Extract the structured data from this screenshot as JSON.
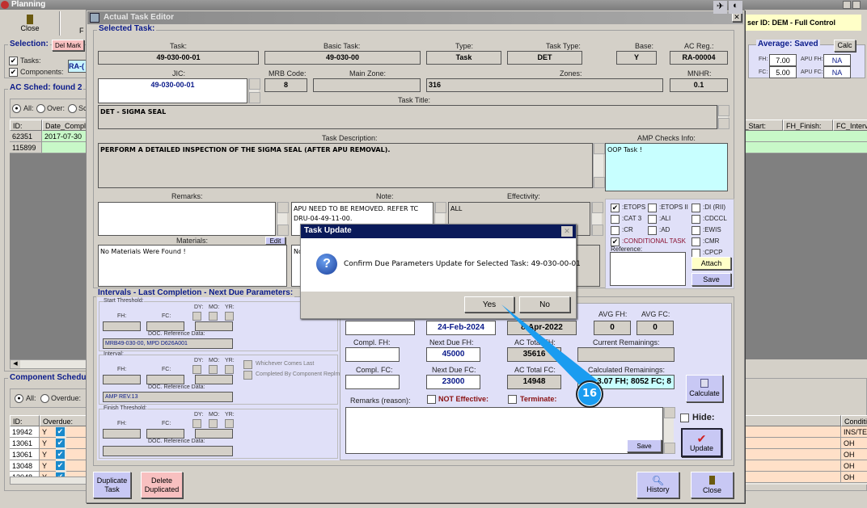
{
  "app": {
    "title": "Planning",
    "toolbar": {
      "close_label": "Close",
      "f_label": "F"
    },
    "user_id": "ser ID: DEM - Full Control",
    "selection": {
      "title": "Selection:",
      "del_mark": "Del Mark",
      "tasks": "Tasks:",
      "components": "Components:",
      "reg_partial": "RA-("
    },
    "average": {
      "title": "Average: Saved",
      "calc": "Calc",
      "fh_label": "FH:",
      "fh": "7.00",
      "fc_label": "FC:",
      "fc": "5.00",
      "apu_fh_label": "APU FH:",
      "apu_fh": "NA",
      "apu_fc_label": "APU FC:",
      "apu_fc": "NA"
    },
    "ac_sched": {
      "title": "AC Sched:  found  2",
      "radios": [
        "All:",
        "Over:",
        "Sc"
      ],
      "columns": [
        "ID:",
        "Date_Compl",
        "H_Start:",
        "FH_Finish:",
        "FC_Interv"
      ],
      "rows": [
        {
          "id": "62351",
          "date": "2017-07-30"
        },
        {
          "id": "115899",
          "date": ""
        }
      ]
    },
    "component_schedule": {
      "title": "Component Schedul",
      "radios": [
        "All:",
        "Overdue:"
      ],
      "columns": [
        "ID:",
        "Overdue:",
        "Conditio"
      ],
      "rows": [
        {
          "id": "19942",
          "overdue": "Y",
          "condition": "INS/TES"
        },
        {
          "id": "13061",
          "overdue": "Y",
          "condition": "OH"
        },
        {
          "id": "13061",
          "overdue": "Y",
          "condition": "OH"
        },
        {
          "id": "13048",
          "overdue": "Y",
          "condition": "OH"
        },
        {
          "id": "13048",
          "overdue": "Y",
          "condition": "OH"
        }
      ]
    }
  },
  "editor": {
    "title": "Actual Task Editor",
    "selected_task": {
      "title": "Selected Task:",
      "task_label": "Task:",
      "task": "49-030-00-01",
      "basic_task_label": "Basic Task:",
      "basic_task": "49-030-00",
      "type_label": "Type:",
      "type": "Task",
      "task_type_label": "Task Type:",
      "task_type": "DET",
      "base_label": "Base:",
      "base": "Y",
      "ac_reg_label": "AC Reg.:",
      "ac_reg": "RA-00004",
      "jic_label": "JIC:",
      "jic": "49-030-00-01",
      "mrb_label": "MRB Code:",
      "mrb": "8",
      "main_zone_label": "Main Zone:",
      "main_zone": "",
      "zones_label": "Zones:",
      "zones": "316",
      "mnhr_label": "MNHR:",
      "mnhr": "0.1",
      "title_label": "Task Title:",
      "task_title": "DET - SIGMA SEAL",
      "desc_label": "Task Description:",
      "description": "PERFORM A DETAILED INSPECTION OF THE SIGMA SEAL (AFTER APU REMOVAL).",
      "amp_label": "AMP Checks Info:",
      "amp": "OOP Task !",
      "remarks_label": "Remarks:",
      "remarks": "",
      "note_label": "Note:",
      "note": "APU NEED TO BE REMOVED. REFER TC DRU-04-49-11-00.",
      "effectivity_label": "Effectivity:",
      "effectivity": "ALL",
      "materials_label": "Materials:",
      "materials_edit": "Edit",
      "materials": "No Materials Were Found !",
      "note2": "No"
    },
    "flags": {
      "items": [
        {
          "label": ":ETOPS",
          "checked": true
        },
        {
          "label": ":ETOPS II",
          "checked": false
        },
        {
          "label": ":DI (RII)",
          "checked": false
        },
        {
          "label": ":CAT 3",
          "checked": false
        },
        {
          "label": ":ALI",
          "checked": false
        },
        {
          "label": ":CDCCL",
          "checked": false
        },
        {
          "label": ":CR",
          "checked": false
        },
        {
          "label": ":AD",
          "checked": false
        },
        {
          "label": ":EWIS",
          "checked": false
        },
        {
          "label": ":CONDITIONAL TASK",
          "checked": true
        },
        {
          "label": ":CMR",
          "checked": false
        },
        {
          "label": ":CPCP",
          "checked": false
        }
      ],
      "reference_label": "Reference:",
      "attach": "Attach",
      "save": "Save"
    },
    "intervals": {
      "title": "Intervals - Last Completion - Next Due Parameters:",
      "fh": "FH:",
      "fc": "FC:",
      "dy": "DY:",
      "mo": "MO:",
      "yr": "YR:",
      "doc_ref": "DOC. Reference Data:",
      "start_title": "Start Threshold:",
      "start_doc": "MRB49-030-00, MPD D626A001",
      "interval_title": "Interval:",
      "interval_doc": "AMP REV.13",
      "whichever": "Whichever Comes Last",
      "completed_by": "Completed By Component Replm.",
      "finish_title": "Finish Threshold:",
      "finish_doc": ""
    },
    "due": {
      "compl_date": "",
      "next_due_date": "24-Feb-2024",
      "ac_date": "8-Apr-2022",
      "avg_fh_label": "AVG FH:",
      "avg_fh": "0",
      "avg_fc_label": "AVG FC:",
      "avg_fc": "0",
      "compl_fh_label": "Compl. FH:",
      "compl_fh": "",
      "next_fh_label": "Next Due FH:",
      "next_fh": "45000",
      "ac_total_fh_label": "AC Total FH:",
      "ac_total_fh": "35616",
      "current_rem_label": "Current Remainings:",
      "current_rem": "",
      "compl_fc_label": "Compl. FC:",
      "compl_fc": "",
      "next_fc_label": "Next Due FC:",
      "next_fc": "23000",
      "ac_total_fc_label": "AC Total FC:",
      "ac_total_fc": "14948",
      "calc_rem_label": "Calculated Remainings:",
      "calc_rem": "3.07 FH;  8052 FC;  8",
      "calculate": "Calculate",
      "remarks_reason_label": "Remarks (reason):",
      "not_effective": "NOT Effective:",
      "terminate": "Terminate:",
      "save": "Save",
      "hide": "Hide:",
      "update": "Update"
    },
    "bottom": {
      "duplicate": "Duplicate Task",
      "delete_dup": "Delete Duplicated",
      "history": "History",
      "close": "Close"
    }
  },
  "dialog": {
    "title": "Task Update",
    "message": "Confirm Due Parameters Update for Selected Task: 49-030-00-01",
    "yes": "Yes",
    "no": "No"
  },
  "annotation": {
    "step": "16",
    "color": "#1a9cf0"
  }
}
